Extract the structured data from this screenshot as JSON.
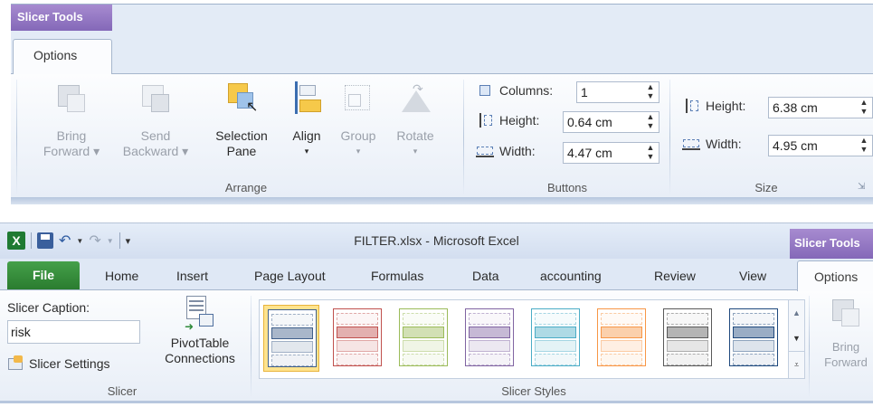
{
  "top": {
    "context_title": "Slicer Tools",
    "active_tab": "Options",
    "arrange": {
      "label": "Arrange",
      "bring_forward": [
        "Bring",
        "Forward ▾"
      ],
      "send_backward": [
        "Send",
        "Backward ▾"
      ],
      "selection_pane": [
        "Selection",
        "Pane"
      ],
      "align": [
        "Align",
        "▾"
      ],
      "group": [
        "Group",
        "▾"
      ],
      "rotate": [
        "Rotate",
        "▾"
      ]
    },
    "buttons": {
      "label": "Buttons",
      "columns_label": "Columns:",
      "columns_value": "1",
      "height_label": "Height:",
      "height_value": "0.64 cm",
      "width_label": "Width:",
      "width_value": "4.47 cm"
    },
    "size": {
      "label": "Size",
      "height_label": "Height:",
      "height_value": "6.38 cm",
      "width_label": "Width:",
      "width_value": "4.95 cm"
    }
  },
  "bottom": {
    "window_title": "FILTER.xlsx - Microsoft Excel",
    "context_title": "Slicer Tools",
    "tabs": [
      "File",
      "Home",
      "Insert",
      "Page Layout",
      "Formulas",
      "Data",
      "accounting",
      "Review",
      "View",
      "Options"
    ],
    "slicer": {
      "label": "Slicer",
      "caption_label": "Slicer Caption:",
      "caption_value": "risk",
      "settings_label": "Slicer Settings",
      "pivot_line1": "PivotTable",
      "pivot_line2": "Connections"
    },
    "styles": {
      "label": "Slicer Styles",
      "swatch_colors": [
        "#3f5f8a",
        "#c0504d",
        "#9bbb59",
        "#8064a2",
        "#4bacc6",
        "#f79646",
        "#595959",
        "#1f497d"
      ],
      "selected_index": 0
    },
    "bring_forward": [
      "Bring",
      "Forward"
    ]
  }
}
